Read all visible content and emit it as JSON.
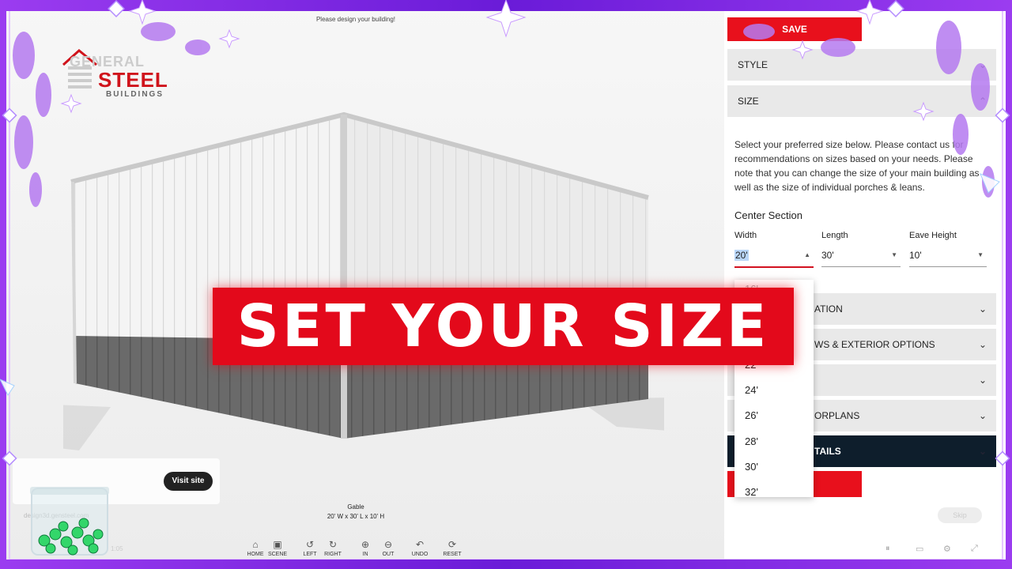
{
  "app": {
    "top_message": "Please design your building!",
    "logo": {
      "line1": "GENERAL",
      "line2": "STEEL",
      "line3": "BUILDINGS"
    }
  },
  "viewer": {
    "info_style": "Gable",
    "info_dims": "20' W x 30' L x 10' H",
    "visit_site": "Visit site",
    "faint_url": "design3d.gensteel.com",
    "faint_time": "1:05"
  },
  "toolbar": [
    {
      "icon": "⌂",
      "label": "HOME",
      "icon_name": "home-icon"
    },
    {
      "icon": "▣",
      "label": "SCENE",
      "icon_name": "scene-icon"
    },
    {
      "icon": "↺",
      "label": "LEFT",
      "icon_name": "rotate-left-icon"
    },
    {
      "icon": "↻",
      "label": "RIGHT",
      "icon_name": "rotate-right-icon"
    },
    {
      "icon": "⊕",
      "label": "IN",
      "icon_name": "zoom-in-icon"
    },
    {
      "icon": "⊖",
      "label": "OUT",
      "icon_name": "zoom-out-icon"
    },
    {
      "icon": "↶",
      "label": "UNDO",
      "icon_name": "undo-icon"
    },
    {
      "icon": "⟳",
      "label": "RESET",
      "icon_name": "reset-icon"
    }
  ],
  "panel": {
    "save_label": "SAVE",
    "style_label": "STYLE",
    "size_label": "SIZE",
    "size_description": "Select your preferred size below. Please contact us for recommendations on sizes based on your needs. Please note that you can change the size of your main building as well as the size of individual porches & leans.",
    "center_section": "Center Section",
    "fields": {
      "width": {
        "label": "Width",
        "value": "20'"
      },
      "length": {
        "label": "Length",
        "value": "30'"
      },
      "eave": {
        "label": "Eave Height",
        "value": "10'"
      }
    },
    "accordions": [
      {
        "label": "ATION"
      },
      {
        "label": "WS & EXTERIOR OPTIONS"
      },
      {
        "label": ""
      },
      {
        "label": "ORPLANS"
      }
    ],
    "details_label": "TAILS",
    "width_options": [
      "16'",
      "22'",
      "24'",
      "26'",
      "28'",
      "30'",
      "32'"
    ],
    "skip_label": "Skip"
  },
  "overlay": {
    "title": "SET YOUR SIZE"
  },
  "colors": {
    "accent_red": "#e8101c",
    "dark_navy": "#0e1e2c",
    "frame_purple": "#8a2be2"
  }
}
